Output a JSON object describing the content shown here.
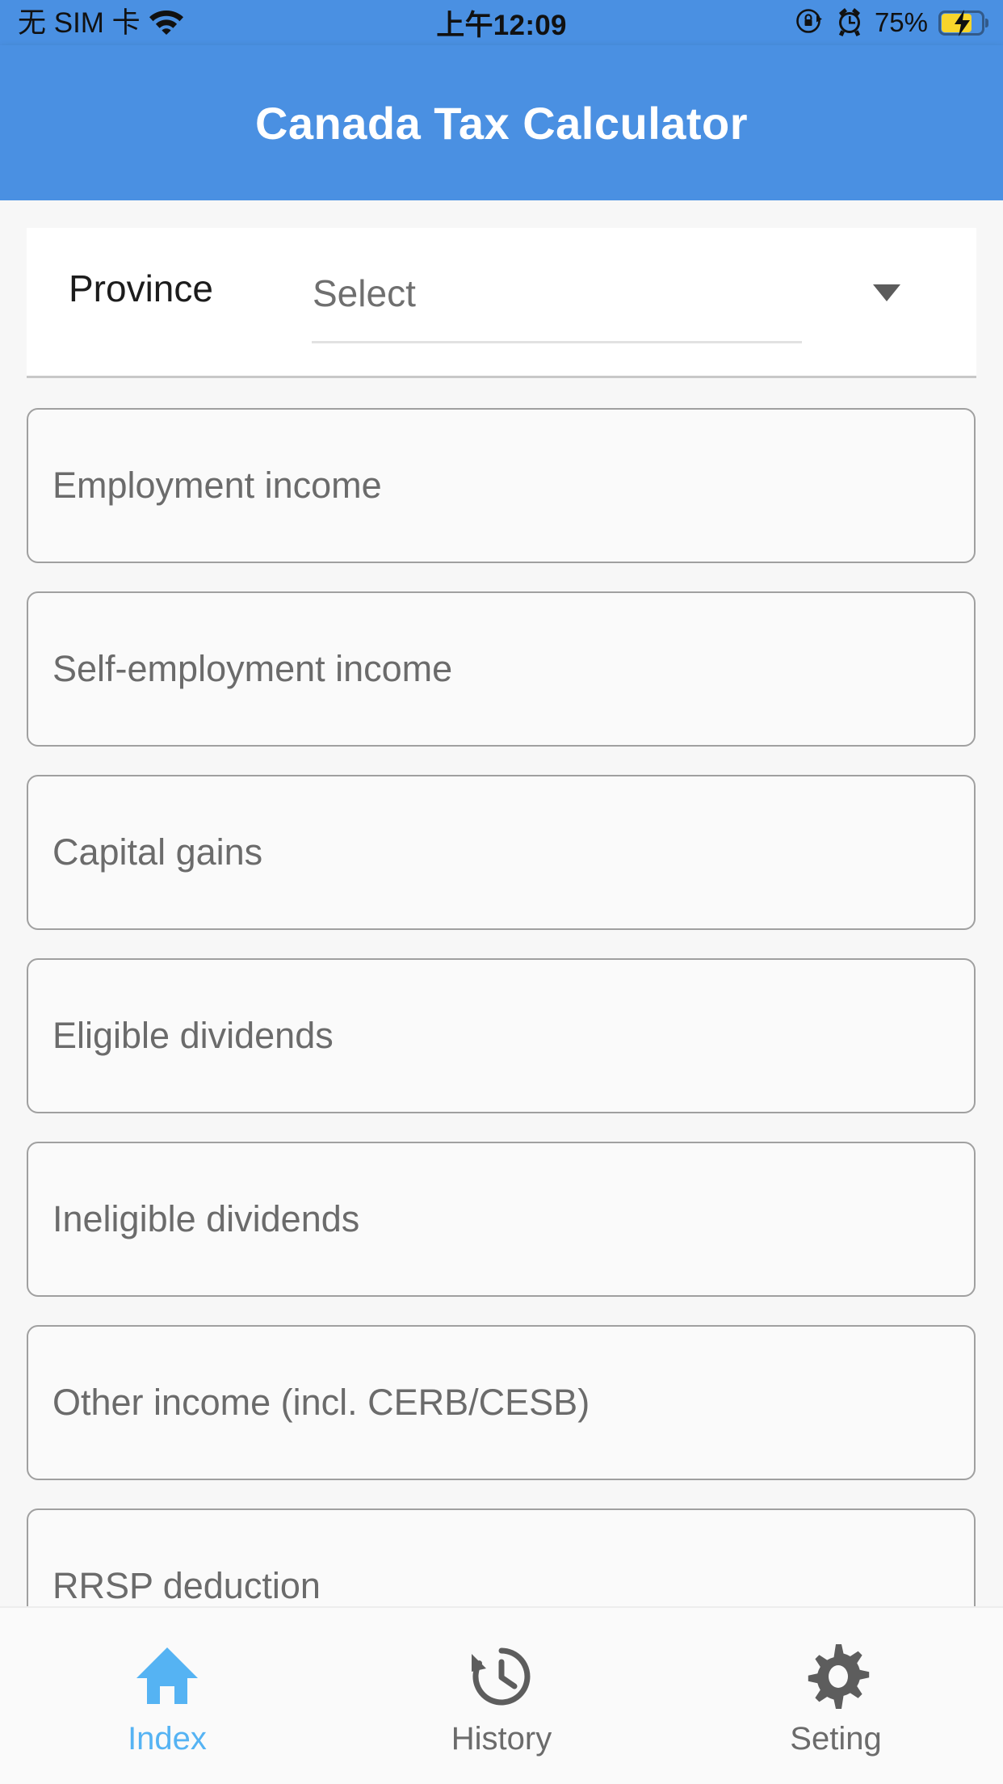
{
  "status_bar": {
    "carrier": "无 SIM 卡",
    "wifi_icon": "wifi-icon",
    "time": "上午12:09",
    "rotation_lock_icon": "rotation-lock-icon",
    "alarm_icon": "alarm-clock-icon",
    "battery_percent": "75%",
    "battery_icon": "battery-charging-icon",
    "battery_level": 75
  },
  "app_bar": {
    "title": "Canada Tax Calculator",
    "background_color": "#4a90e2",
    "title_color": "#ffffff"
  },
  "form": {
    "province": {
      "label": "Province",
      "select_value": "Select",
      "caret_icon": "chevron-down-icon"
    },
    "inputs": [
      {
        "placeholder": "Employment income",
        "value": ""
      },
      {
        "placeholder": "Self-employment income",
        "value": ""
      },
      {
        "placeholder": "Capital gains",
        "value": ""
      },
      {
        "placeholder": "Eligible dividends",
        "value": ""
      },
      {
        "placeholder": "Ineligible dividends",
        "value": ""
      },
      {
        "placeholder": "Other income (incl. CERB/CESB)",
        "value": ""
      },
      {
        "placeholder": "RRSP deduction",
        "value": ""
      }
    ]
  },
  "tab_bar": {
    "active_color": "#55b3f3",
    "inactive_color": "#6b6b6b",
    "items": [
      {
        "label": "Index",
        "icon": "home-icon",
        "active": true
      },
      {
        "label": "History",
        "icon": "history-clock-icon",
        "active": false
      },
      {
        "label": "Seting",
        "icon": "gear-icon",
        "active": false
      }
    ]
  }
}
